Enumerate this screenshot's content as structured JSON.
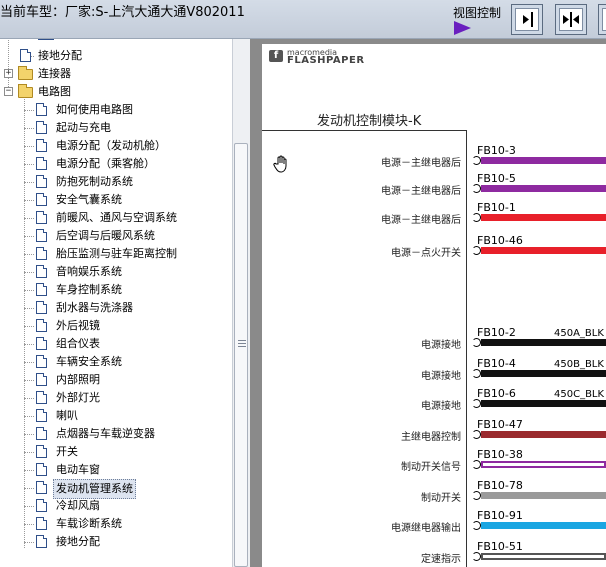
{
  "header": {
    "title": "当前车型：厂家:S-上汽大通大通V802011",
    "view_control_label": "视图控制",
    "buttons": [
      "fit-width-icon",
      "fit-page-icon",
      "next-icon"
    ]
  },
  "tree": {
    "top_items": [
      {
        "label": "接地分配",
        "type": "doc"
      },
      {
        "label": "连接器",
        "type": "folder",
        "expanded": false
      },
      {
        "label": "电路图",
        "type": "folder",
        "expanded": true
      }
    ],
    "children": [
      "如何使用电路图",
      "起动与充电",
      "电源分配（发动机舱）",
      "电源分配（乘客舱）",
      "防抱死制动系统",
      "安全气囊系统",
      "前暖风、通风与空调系统",
      "后空调与后暖风系统",
      "胎压监测与驻车距离控制",
      "音响娱乐系统",
      "车身控制系统",
      "刮水器与洗涤器",
      "外后视镜",
      "组合仪表",
      "车辆安全系统",
      "内部照明",
      "外部灯光",
      "喇叭",
      "点烟器与车载逆变器",
      "开关",
      "电动车窗",
      "发动机管理系统",
      "冷却风扇",
      "车载诊断系统",
      "接地分配"
    ],
    "selected": "发动机管理系统"
  },
  "viewer": {
    "logo_small": "macromedia",
    "logo_big": "FLASHPAPER",
    "module_title": "发动机控制模块-K",
    "pins": [
      {
        "connector": "FB10-3",
        "label": "电源－主继电器后",
        "wire_label": "",
        "color": "#8e2aa0",
        "style": "solid"
      },
      {
        "connector": "FB10-5",
        "label": "电源－主继电器后",
        "wire_label": "",
        "color": "#8e2aa0",
        "style": "solid"
      },
      {
        "connector": "FB10-1",
        "label": "电源－主继电器后",
        "wire_label": "",
        "color": "#e8202a",
        "style": "solid"
      },
      {
        "connector": "FB10-46",
        "label": "电源－点火开关",
        "wire_label": "",
        "color": "#e8202a",
        "style": "solid"
      },
      {
        "connector": "FB10-2",
        "label": "电源接地",
        "wire_label": "450A_BLK",
        "color": "#111111",
        "style": "solid"
      },
      {
        "connector": "FB10-4",
        "label": "电源接地",
        "wire_label": "450B_BLK",
        "color": "#111111",
        "style": "solid"
      },
      {
        "connector": "FB10-6",
        "label": "电源接地",
        "wire_label": "450C_BLK",
        "color": "#111111",
        "style": "solid"
      },
      {
        "connector": "FB10-47",
        "label": "主继电器控制",
        "wire_label": "",
        "color": "#9a2a2e",
        "style": "solid"
      },
      {
        "connector": "FB10-38",
        "label": "制动开关信号",
        "wire_label": "",
        "color": "#8e2aa0",
        "style": "outline"
      },
      {
        "connector": "FB10-78",
        "label": "制动开关",
        "wire_label": "",
        "color": "#9a9a9a",
        "style": "solid"
      },
      {
        "connector": "FB10-91",
        "label": "电源继电器输出",
        "wire_label": "",
        "color": "#1aa6e2",
        "style": "solid"
      },
      {
        "connector": "FB10-51",
        "label": "定速指示",
        "wire_label": "",
        "color": "#555555",
        "style": "outline"
      }
    ]
  }
}
